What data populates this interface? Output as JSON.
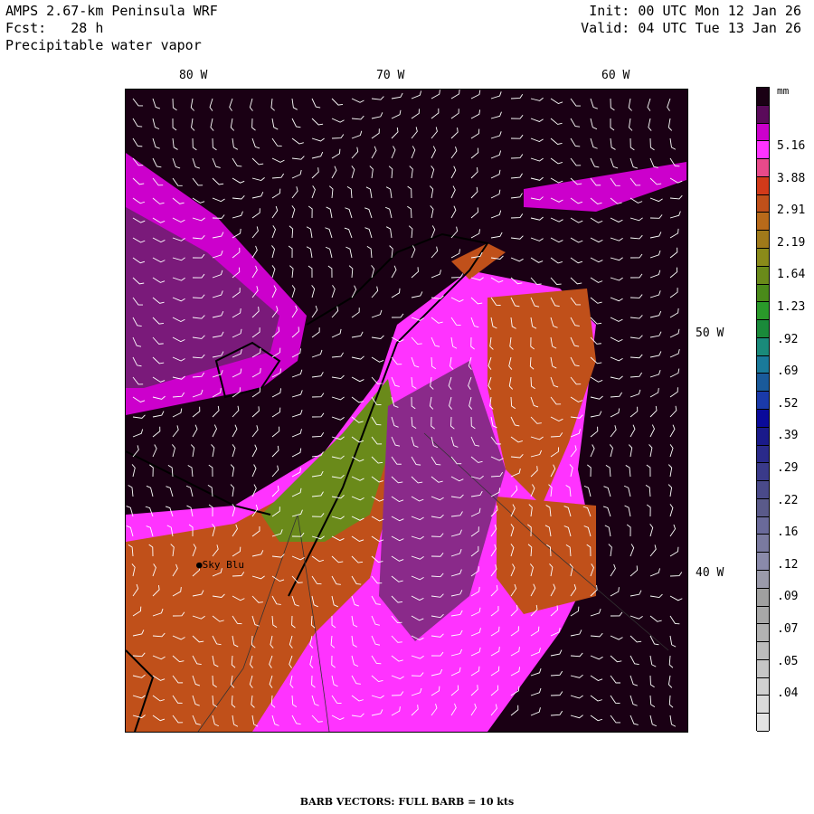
{
  "header": {
    "title": "AMPS 2.67-km Peninsula WRF",
    "forecast_label": "Fcst:   28 h",
    "field": "Precipitable water vapor",
    "init": "Init: 00 UTC Mon 12 Jan 26",
    "valid": "Valid: 04 UTC Tue 13 Jan 26"
  },
  "longitude_labels": [
    "80 W",
    "70 W",
    "60 W"
  ],
  "latitude_labels": [
    "50 W",
    "40 W"
  ],
  "colorbar": {
    "units": "mm",
    "labels": [
      "5.16",
      "3.88",
      "2.91",
      "2.19",
      "1.64",
      "1.23",
      ".92",
      ".69",
      ".52",
      ".39",
      ".29",
      ".22",
      ".16",
      ".12",
      ".09",
      ".07",
      ".05",
      ".04"
    ],
    "colors": [
      "#1a0014",
      "#5a0a5a",
      "#cc00cc",
      "#ff33ff",
      "#e84a8a",
      "#d23a1a",
      "#c0501a",
      "#b86a1a",
      "#a07a1a",
      "#8a8a1a",
      "#6a8a1a",
      "#4a8a1a",
      "#2a9a2a",
      "#1a8a3a",
      "#1a8a7a",
      "#1a7a9a",
      "#1a5a9a",
      "#1a3aaa",
      "#0a0a9a",
      "#1a1a8a",
      "#2a2a8a",
      "#3a3a8a",
      "#4a4a8a",
      "#5a5a8a",
      "#6a6a9a",
      "#7a7aa0",
      "#8a8aaa",
      "#9a9aaa",
      "#a0a0a0",
      "#a8a8a8",
      "#b2b2b2",
      "#bcbcbc",
      "#c6c6c6",
      "#d0d0d0",
      "#dadada",
      "#e4e4e4"
    ]
  },
  "station": {
    "name": "Sky Blu"
  },
  "footer": "BARB VECTORS:  FULL BARB = 10 kts"
}
